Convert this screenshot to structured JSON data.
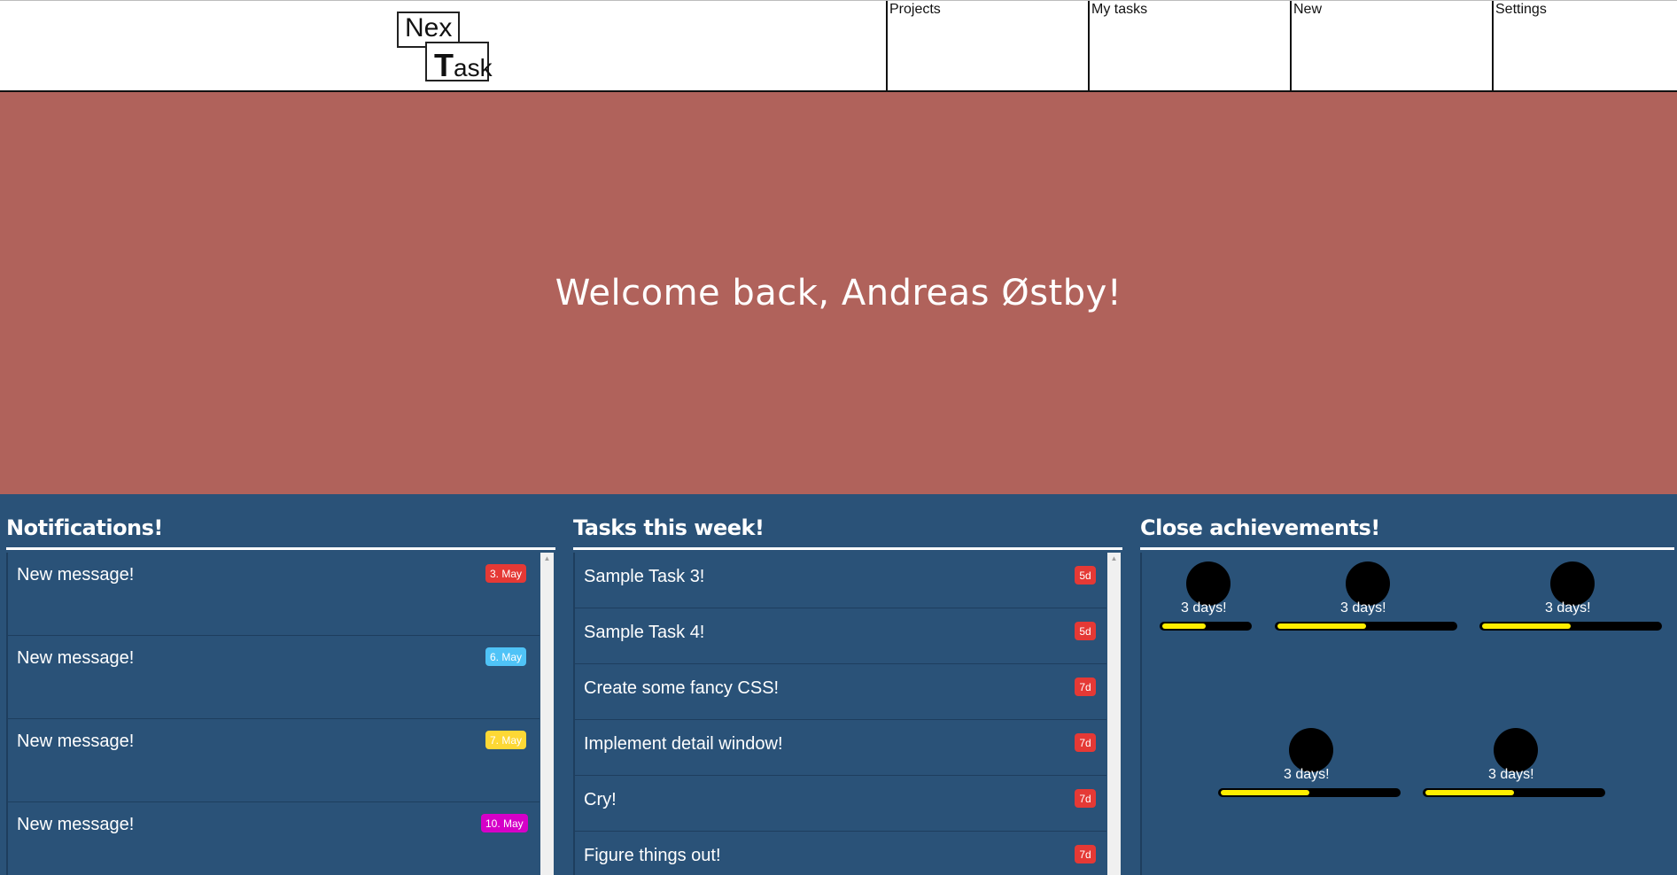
{
  "header": {
    "logo": {
      "line1": "Nex",
      "line2_initial": "T",
      "line2_rest": "ask"
    },
    "nav": [
      "Projects",
      "My tasks",
      "New",
      "Settings"
    ]
  },
  "hero": {
    "welcome": "Welcome back, Andreas Østby!",
    "background_color": "#b0625b"
  },
  "notifications": {
    "title": "Notifications!",
    "items": [
      {
        "text": "New message!",
        "date": "3. May",
        "badge_color": "#e53935"
      },
      {
        "text": "New message!",
        "date": "6. May",
        "badge_color": "#4fc3f7"
      },
      {
        "text": "New message!",
        "date": "7. May",
        "badge_color": "#fdd835"
      },
      {
        "text": "New message!",
        "date": "10. May",
        "badge_color": "#d500c8"
      }
    ]
  },
  "tasks": {
    "title": "Tasks this week!",
    "items": [
      {
        "text": "Sample Task 3!",
        "due": "5d"
      },
      {
        "text": "Sample Task 4!",
        "due": "5d"
      },
      {
        "text": "Create some fancy CSS!",
        "due": "7d"
      },
      {
        "text": "Implement detail window!",
        "due": "7d"
      },
      {
        "text": "Cry!",
        "due": "7d"
      },
      {
        "text": "Figure things out!",
        "due": "7d"
      }
    ]
  },
  "achievements": {
    "title": "Close achievements!",
    "items": [
      {
        "label": "3 days!",
        "progress": 0.5
      },
      {
        "label": "3 days!",
        "progress": 0.5
      },
      {
        "label": "3 days!",
        "progress": 0.5
      },
      {
        "label": "3 days!",
        "progress": 0.5
      },
      {
        "label": "3 days!",
        "progress": 0.5
      }
    ]
  },
  "colors": {
    "panel_bg": "#2a5278",
    "due_badge": "#e53935",
    "progress_fill": "#ffee00"
  }
}
